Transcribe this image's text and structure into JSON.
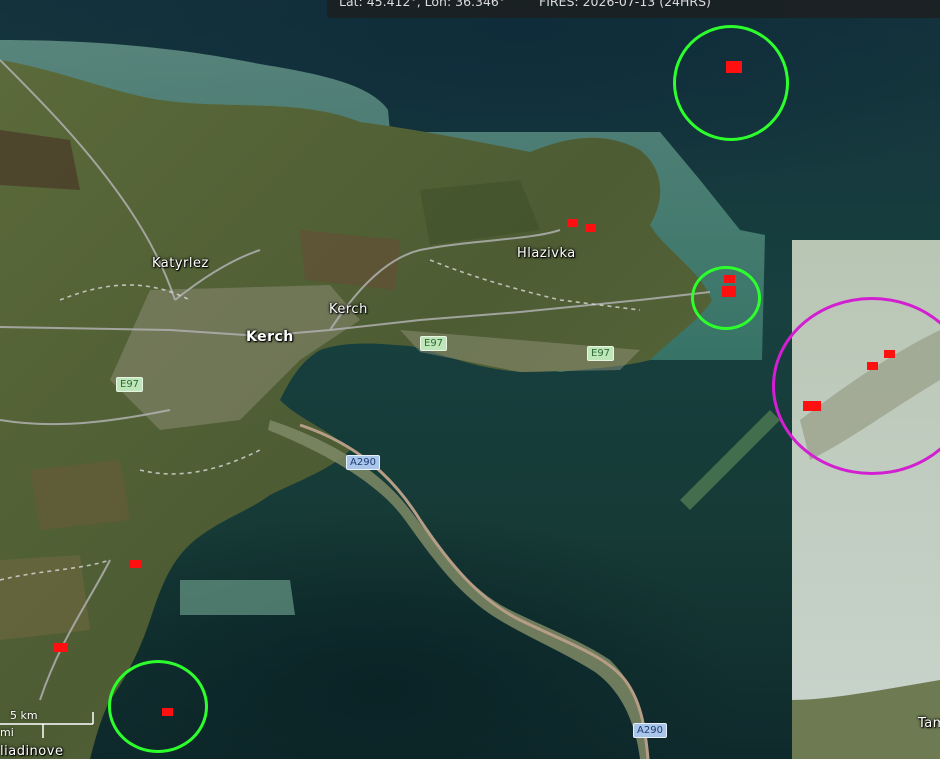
{
  "status": {
    "coords": "Lat: 45.412°, Lon: 36.346°",
    "fires": "FIRES: 2026-07-13 (24HRS)"
  },
  "places": [
    {
      "name": "Katyrlez"
    },
    {
      "name": "Kerch"
    },
    {
      "name": "Kerch"
    },
    {
      "name": "Hlazivka"
    },
    {
      "name": "Tam"
    },
    {
      "name": "liadinove"
    }
  ],
  "roads": [
    {
      "ref": "E97"
    },
    {
      "ref": "E97"
    },
    {
      "ref": "E97"
    },
    {
      "ref": "A290"
    },
    {
      "ref": "A290"
    }
  ],
  "scale": {
    "top": "5 km",
    "bottom": "mi"
  },
  "colors": {
    "fire": "#ff1010",
    "highlight_ring": "#2cff2c",
    "alert_ring": "#d21fd2",
    "eroute_shield": "#bfe6b8",
    "froute_shield": "#a9c6ea"
  }
}
